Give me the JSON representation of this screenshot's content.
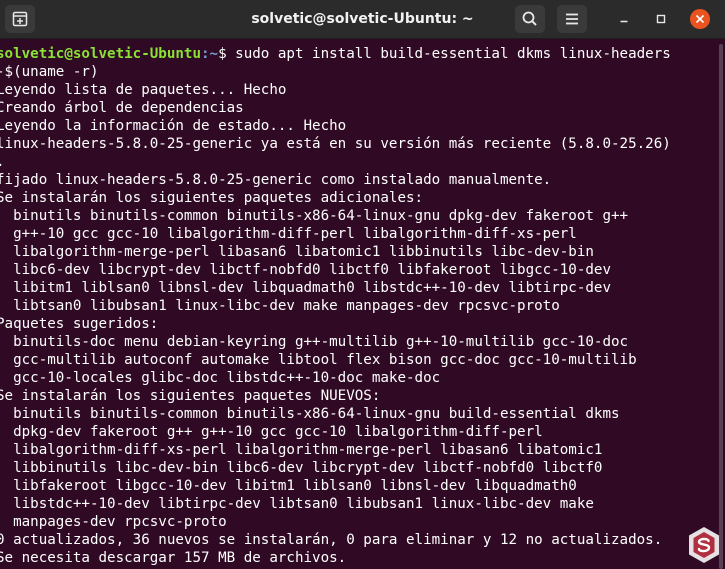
{
  "window": {
    "title": "solvetic@solvetic-Ubuntu: ~"
  },
  "terminal": {
    "prompt": {
      "userhost": "solvetic@solvetic-Ubuntu",
      "path": ":~",
      "symbol": "$"
    },
    "command_line_1": " sudo apt install build-essential dkms linux-headers",
    "command_line_2": "-$(uname -r)",
    "output": [
      "Leyendo lista de paquetes... Hecho",
      "Creando árbol de dependencias",
      "Leyendo la información de estado... Hecho",
      "linux-headers-5.8.0-25-generic ya está en su versión más reciente (5.8.0-25.26)",
      ".",
      "fijado linux-headers-5.8.0-25-generic como instalado manualmente.",
      "Se instalarán los siguientes paquetes adicionales:",
      "  binutils binutils-common binutils-x86-64-linux-gnu dpkg-dev fakeroot g++",
      "  g++-10 gcc gcc-10 libalgorithm-diff-perl libalgorithm-diff-xs-perl",
      "  libalgorithm-merge-perl libasan6 libatomic1 libbinutils libc-dev-bin",
      "  libc6-dev libcrypt-dev libctf-nobfd0 libctf0 libfakeroot libgcc-10-dev",
      "  libitm1 liblsan0 libnsl-dev libquadmath0 libstdc++-10-dev libtirpc-dev",
      "  libtsan0 libubsan1 linux-libc-dev make manpages-dev rpcsvc-proto",
      "Paquetes sugeridos:",
      "  binutils-doc menu debian-keyring g++-multilib g++-10-multilib gcc-10-doc",
      "  gcc-multilib autoconf automake libtool flex bison gcc-doc gcc-10-multilib",
      "  gcc-10-locales glibc-doc libstdc++-10-doc make-doc",
      "Se instalarán los siguientes paquetes NUEVOS:",
      "  binutils binutils-common binutils-x86-64-linux-gnu build-essential dkms",
      "  dpkg-dev fakeroot g++ g++-10 gcc gcc-10 libalgorithm-diff-perl",
      "  libalgorithm-diff-xs-perl libalgorithm-merge-perl libasan6 libatomic1",
      "  libbinutils libc-dev-bin libc6-dev libcrypt-dev libctf-nobfd0 libctf0",
      "  libfakeroot libgcc-10-dev libitm1 liblsan0 libnsl-dev libquadmath0",
      "  libstdc++-10-dev libtirpc-dev libtsan0 libubsan1 linux-libc-dev make",
      "  manpages-dev rpcsvc-proto",
      "0 actualizados, 36 nuevos se instalarán, 0 para eliminar y 12 no actualizados.",
      "Se necesita descargar 157 MB de archivos."
    ]
  },
  "colors": {
    "background": "#300a24",
    "titlebar": "#2b2b2b",
    "prompt_user": "#8ae234",
    "prompt_path": "#729fcf",
    "close_button": "#e95420"
  },
  "icons": {
    "new_tab": "new-tab-icon",
    "search": "search-icon",
    "menu": "hamburger-menu-icon",
    "minimize": "minimize-icon",
    "maximize": "maximize-icon",
    "close": "close-icon",
    "watermark": "solvetic-logo-icon"
  }
}
